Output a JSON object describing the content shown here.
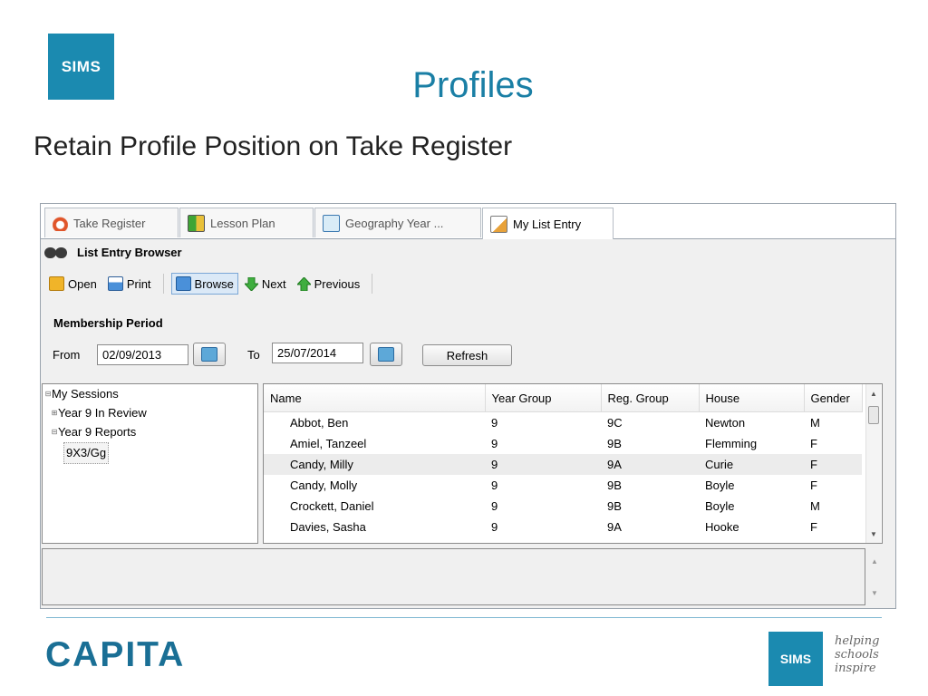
{
  "slide": {
    "logo": "SIMS",
    "title": "Profiles",
    "subtitle": "Retain Profile Position on Take Register"
  },
  "tabs": [
    {
      "label": "Take Register",
      "icon": "clock-register-icon",
      "active": false
    },
    {
      "label": "Lesson Plan",
      "icon": "lesson-plan-icon",
      "active": false
    },
    {
      "label": "Geography Year ...",
      "icon": "document-icon",
      "active": false
    },
    {
      "label": "My List Entry",
      "icon": "edit-list-icon",
      "active": true
    }
  ],
  "panel": {
    "title": "List Entry Browser",
    "icon": "binoculars-icon"
  },
  "toolbar": {
    "open": "Open",
    "print": "Print",
    "browse": "Browse",
    "next": "Next",
    "previous": "Previous"
  },
  "membership": {
    "label": "Membership Period",
    "from_label": "From",
    "from_value": "02/09/2013",
    "to_label": "To",
    "to_value": "25/07/2014",
    "refresh": "Refresh"
  },
  "tree": {
    "items": [
      {
        "label": "My Sessions",
        "exp": "⊟"
      },
      {
        "label": "Year 9 In Review",
        "exp": "⊞"
      },
      {
        "label": "Year 9 Reports",
        "exp": "⊟"
      },
      {
        "label": "9X3/Gg",
        "exp": ""
      }
    ]
  },
  "grid": {
    "columns": [
      "Name",
      "Year Group",
      "Reg. Group",
      "House",
      "Gender"
    ],
    "rows": [
      [
        "Abbot, Ben",
        "9",
        "9C",
        "Newton",
        "M"
      ],
      [
        "Amiel, Tanzeel",
        "9",
        "9B",
        "Flemming",
        "F"
      ],
      [
        "Candy, Milly",
        "9",
        "9A",
        "Curie",
        "F"
      ],
      [
        "Candy, Molly",
        "9",
        "9B",
        "Boyle",
        "F"
      ],
      [
        "Crockett, Daniel",
        "9",
        "9B",
        "Boyle",
        "M"
      ],
      [
        "Davies, Sasha",
        "9",
        "9A",
        "Hooke",
        "F"
      ]
    ],
    "highlighted_row": 2
  },
  "footer": {
    "company": "CAPITA",
    "logo": "SIMS",
    "tagline_1": "helping",
    "tagline_2": "schools",
    "tagline_3": "inspire"
  },
  "colors": {
    "brand_blue": "#1b8ab0",
    "title_blue": "#1a7fa5",
    "capita_blue": "#1a6f95"
  }
}
